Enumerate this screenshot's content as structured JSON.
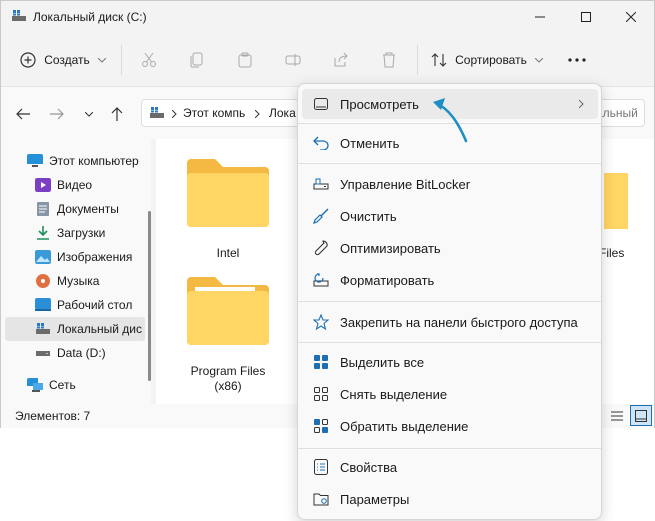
{
  "window": {
    "title": "Локальный диск (C:)"
  },
  "toolbar": {
    "create_label": "Создать",
    "sort_label": "Сортировать"
  },
  "address": {
    "crumb1": "Этот компь",
    "crumb2": "Лока",
    "search_partial": "альный"
  },
  "sidebar": {
    "items": [
      {
        "label": "Этот компьютер",
        "icon": "monitor-icon"
      },
      {
        "label": "Видео",
        "icon": "video-icon"
      },
      {
        "label": "Документы",
        "icon": "documents-icon"
      },
      {
        "label": "Загрузки",
        "icon": "download-icon"
      },
      {
        "label": "Изображения",
        "icon": "pictures-icon"
      },
      {
        "label": "Музыка",
        "icon": "music-icon"
      },
      {
        "label": "Рабочий стол",
        "icon": "desktop-icon"
      },
      {
        "label": "Локальный дис",
        "icon": "drive-c-icon"
      },
      {
        "label": "Data (D:)",
        "icon": "drive-icon"
      },
      {
        "label": "Сеть",
        "icon": "network-icon"
      }
    ]
  },
  "content": {
    "folders": [
      {
        "label": "Intel"
      },
      {
        "label": "Program Files (x86)"
      },
      {
        "label": "Files"
      }
    ]
  },
  "status": {
    "items_count": "Элементов: 7"
  },
  "context_menu": {
    "items": [
      {
        "label": "Просмотреть",
        "icon": "view-icon",
        "has_submenu": true
      },
      {
        "label": "Отменить",
        "icon": "undo-icon"
      },
      {
        "label": "Управление BitLocker",
        "icon": "bitlocker-icon"
      },
      {
        "label": "Очистить",
        "icon": "broom-icon"
      },
      {
        "label": "Оптимизировать",
        "icon": "wrench-icon"
      },
      {
        "label": "Форматировать",
        "icon": "format-icon"
      },
      {
        "label": "Закрепить на панели быстрого доступа",
        "icon": "star-icon"
      },
      {
        "label": "Выделить все",
        "icon": "select-all-icon"
      },
      {
        "label": "Снять выделение",
        "icon": "select-none-icon"
      },
      {
        "label": "Обратить выделение",
        "icon": "invert-selection-icon"
      },
      {
        "label": "Свойства",
        "icon": "properties-icon"
      },
      {
        "label": "Параметры",
        "icon": "options-icon"
      }
    ]
  },
  "colors": {
    "accent": "#1e6fb0",
    "folder": "#ffcd4a",
    "arrow": "#1e8fc4"
  }
}
